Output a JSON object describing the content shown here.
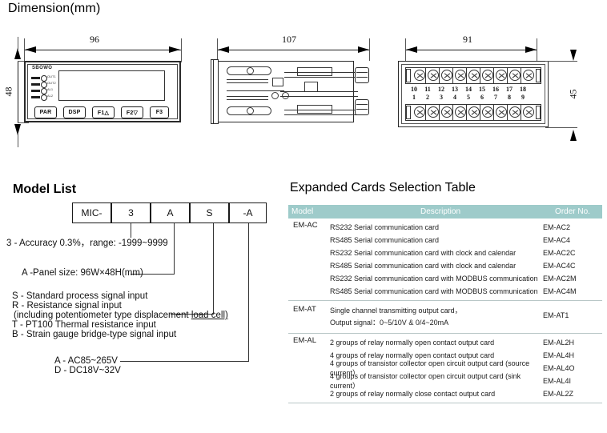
{
  "dimension": {
    "title": "Dimension(mm)",
    "front_view": {
      "width_label": "96",
      "height_label": "48",
      "brand": "SBOWO",
      "buttons": [
        "PAR",
        "DSP",
        "F1△",
        "F2▽",
        "F3"
      ],
      "leds": [
        "OUT1",
        "OUT2",
        "AL1",
        "AL2"
      ]
    },
    "side_view": {
      "length_label": "107"
    },
    "rear_view": {
      "width_label": "91",
      "height_label": "45",
      "terminals_top": [
        "10",
        "11",
        "12",
        "13",
        "14",
        "15",
        "16",
        "17",
        "18"
      ],
      "terminals_bottom": [
        "1",
        "2",
        "3",
        "4",
        "5",
        "6",
        "7",
        "8",
        "9"
      ]
    }
  },
  "model_list": {
    "title": "Model List",
    "code_boxes": [
      "MIC-",
      "3",
      "A",
      "S",
      "-A"
    ],
    "notes": {
      "accuracy": "3 - Accuracy 0.3%，range: -1999~9999",
      "panel_size": "A -Panel size: 96W×48H(mm)",
      "input_s": "S - Standard process signal input",
      "input_r": "R - Resistance signal input",
      "input_r_sub": "(including potentiometer type displacement ",
      "input_r_sub_underline": "load cell)",
      "input_t": "T - PT100 Thermal resistance input",
      "input_b": "B - Strain gauge bridge-type signal input",
      "power_a": "A - AC85~265V",
      "power_d": "D - DC18V~32V"
    }
  },
  "cards_table": {
    "title": "Expanded Cards Selection Table",
    "header_color": "#9ecbca",
    "columns": [
      "Model",
      "Description",
      "Order No."
    ],
    "groups": [
      {
        "model": "EM-AC",
        "rows": [
          {
            "description": "RS232 Serial communication card",
            "order": "EM-AC2"
          },
          {
            "description": "RS485 Serial communication card",
            "order": "EM-AC4"
          },
          {
            "description": "RS232 Serial communication card with clock and calendar",
            "order": "EM-AC2C"
          },
          {
            "description": "RS485 Serial communication card with clock and calendar",
            "order": "EM-AC4C"
          },
          {
            "description": "RS232 Serial communication card with MODBUS communication",
            "order": "EM-AC2M"
          },
          {
            "description": "RS485 Serial communication card with MODBUS communication",
            "order": "EM-AC4M"
          }
        ]
      },
      {
        "model": "EM-AT",
        "rows": [
          {
            "description": "Single channel transmitting output card，",
            "description2": "Output signal：0~5/10V & 0/4~20mA",
            "order": "EM-AT1"
          }
        ]
      },
      {
        "model": "EM-AL",
        "rows": [
          {
            "description": "2 groups of relay normally open contact output card",
            "order": "EM-AL2H"
          },
          {
            "description": "4 groups of relay normally open contact output card",
            "order": "EM-AL4H"
          },
          {
            "description": "4 groups of transistor collector open circuit output card (source current）",
            "order": "EM-AL4O"
          },
          {
            "description": "4 groups of transistor collector open circuit output card (sink current）",
            "order": "EM-AL4I"
          },
          {
            "description": "2 groups of relay normally close contact output card",
            "order": "EM-AL2Z"
          }
        ]
      }
    ]
  }
}
